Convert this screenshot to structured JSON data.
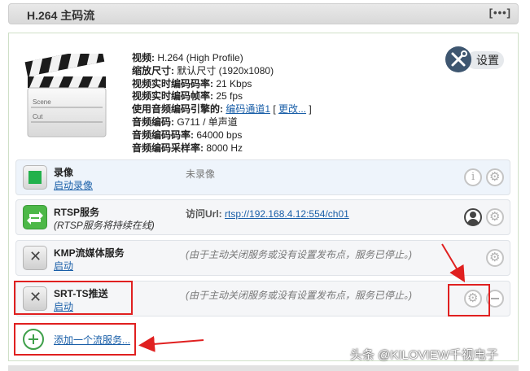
{
  "header": {
    "title": "H.264 主码流",
    "menu": "[•••]"
  },
  "clapper": {
    "line1": "Scene",
    "line2": "Cut"
  },
  "info": [
    {
      "label": "视频:",
      "value": "H.264 (High Profile)"
    },
    {
      "label": "缩放尺寸:",
      "value": "默认尺寸 (1920x1080)"
    },
    {
      "label": "视频实时编码码率:",
      "value": "21 Kbps"
    },
    {
      "label": "视频实时编码帧率:",
      "value": "25 fps"
    },
    {
      "label": "使用音频编码引擎的:",
      "value_link": "编码通道1",
      "bracket_open": " [ ",
      "change_link": "更改...",
      "bracket_close": " ]"
    },
    {
      "label": "音频编码:",
      "value": "G711 / 单声道"
    },
    {
      "label": "音频编码码率:",
      "value": "64000 bps"
    },
    {
      "label": "音频编码采样率:",
      "value": "8000 Hz"
    }
  ],
  "settings": {
    "label": "设置",
    "icon": "tools-icon"
  },
  "rows": [
    {
      "title": "录像",
      "sub": "启动录像",
      "status": "未录像",
      "icon": "record-icon",
      "color": "#22b14c"
    },
    {
      "title": "RTSP服务",
      "sub": "(RTSP服务将持续在线)",
      "status_label": "访问Url:",
      "status_link": "rtsp://192.168.4.12:554/ch01",
      "icon": "rtsp-icon",
      "color": "#4db848"
    },
    {
      "title": "KMP流媒体服务",
      "sub": "启动",
      "status": "(由于主动关闭服务或没有设置发布点，服务已停止。)",
      "icon": "stopped-icon"
    },
    {
      "title": "SRT-TS推送",
      "sub": "启动",
      "status": "(由于主动关闭服务或没有设置发布点，服务已停止。)",
      "icon": "stopped-icon"
    }
  ],
  "add": {
    "label": "添加一个流服务..."
  },
  "annotation_color": "#e02020",
  "watermark": "头条 @KILOVIEW千视电子"
}
